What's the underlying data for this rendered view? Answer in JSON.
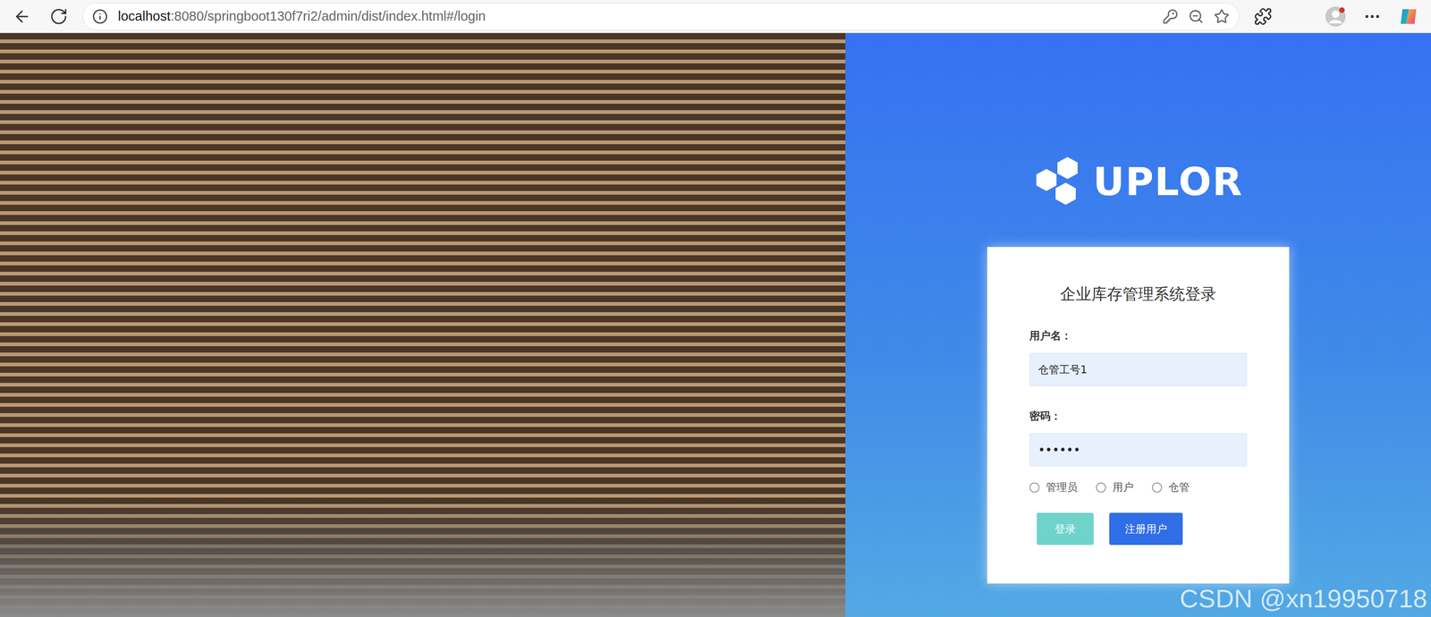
{
  "browser": {
    "host": "localhost",
    "path": ":8080/springboot130f7ri2/admin/dist/index.html#/login"
  },
  "logo": {
    "text": "UPLOR"
  },
  "login": {
    "title": "企业库存管理系统登录",
    "fields": [
      {
        "label": "用户名：",
        "value": "仓管工号1",
        "kind": "text"
      },
      {
        "label": "密码：",
        "value": "••••••",
        "kind": "password"
      }
    ],
    "roles": [
      {
        "label": "管理员",
        "selected": false
      },
      {
        "label": "用户",
        "selected": false
      },
      {
        "label": "仓管",
        "selected": false
      }
    ],
    "buttons": [
      {
        "label": "登录",
        "color": "#6fd3cc"
      },
      {
        "label": "注册用户",
        "color": "#2f6ee6"
      }
    ]
  },
  "watermark": "CSDN @xn19950718"
}
